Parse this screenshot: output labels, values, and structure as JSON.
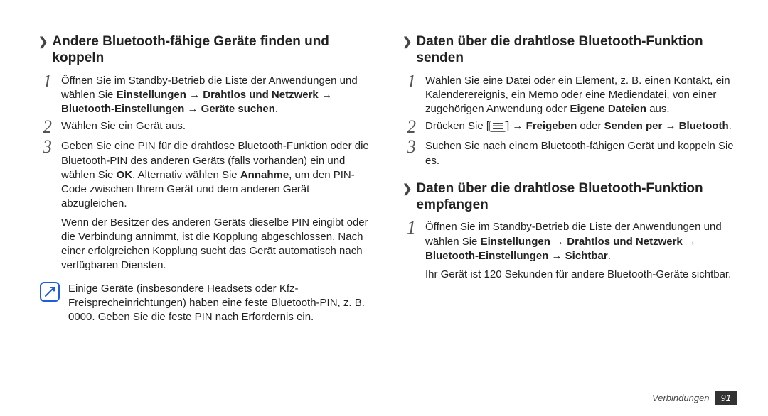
{
  "left": {
    "h1": {
      "chev": "❯",
      "text": "Andere Bluetooth-fähige Geräte finden und koppeln"
    },
    "steps": [
      {
        "num": "1",
        "parts": [
          {
            "t": "Öffnen Sie im Standby-Betrieb die Liste der Anwendungen und wählen Sie "
          },
          {
            "t": "Einstellungen",
            "b": true
          },
          {
            "t": " → ",
            "a": true
          },
          {
            "t": "Drahtlos und Netzwerk",
            "b": true
          },
          {
            "t": " → ",
            "a": true
          },
          {
            "t": "Bluetooth-Einstellungen",
            "b": true
          },
          {
            "t": " → ",
            "a": true
          },
          {
            "t": "Geräte suchen",
            "b": true
          },
          {
            "t": "."
          }
        ]
      },
      {
        "num": "2",
        "parts": [
          {
            "t": "Wählen Sie ein Gerät aus."
          }
        ]
      },
      {
        "num": "3",
        "parts": [
          {
            "t": "Geben Sie eine PIN für die drahtlose Bluetooth-Funktion oder die Bluetooth-PIN des anderen Geräts (falls vorhanden) ein und wählen Sie "
          },
          {
            "t": "OK",
            "b": true
          },
          {
            "t": ". Alternativ wählen Sie "
          },
          {
            "t": "Annahme",
            "b": true
          },
          {
            "t": ", um den PIN-Code zwischen Ihrem Gerät und dem anderen Gerät abzugleichen."
          }
        ]
      }
    ],
    "para": "Wenn der Besitzer des anderen Geräts dieselbe PIN eingibt oder die Verbindung annimmt, ist die Kopplung abgeschlossen. Nach einer erfolgreichen Kopplung sucht das Gerät automatisch nach verfügbaren Diensten.",
    "note": "Einige Geräte (insbesondere Headsets oder Kfz-Freisprecheinrichtungen) haben eine feste Bluetooth-PIN, z. B. 0000. Geben Sie die feste PIN nach Erfordernis ein."
  },
  "right": {
    "h1": {
      "chev": "❯",
      "text": "Daten über die drahtlose Bluetooth-Funktion senden"
    },
    "steps1": [
      {
        "num": "1",
        "parts": [
          {
            "t": "Wählen Sie eine Datei oder ein Element, z. B. einen Kontakt, ein Kalenderereignis, ein Memo oder eine Mediendatei, von einer zugehörigen Anwendung oder "
          },
          {
            "t": "Eigene Dateien",
            "b": true
          },
          {
            "t": " aus."
          }
        ]
      },
      {
        "num": "2",
        "parts": [
          {
            "t": "Drücken Sie ["
          },
          {
            "menu": true
          },
          {
            "t": "] → "
          },
          {
            "t": "Freigeben",
            "b": true
          },
          {
            "t": " oder "
          },
          {
            "t": "Senden per",
            "b": true
          },
          {
            "t": " → ",
            "a": true
          },
          {
            "t": "Bluetooth",
            "b": true
          },
          {
            "t": "."
          }
        ]
      },
      {
        "num": "3",
        "parts": [
          {
            "t": "Suchen Sie nach einem Bluetooth-fähigen Gerät und koppeln Sie es."
          }
        ]
      }
    ],
    "h2": {
      "chev": "❯",
      "text": "Daten über die drahtlose Bluetooth-Funktion empfangen"
    },
    "steps2": [
      {
        "num": "1",
        "parts": [
          {
            "t": "Öffnen Sie im Standby-Betrieb die Liste der Anwendungen und wählen Sie "
          },
          {
            "t": "Einstellungen",
            "b": true
          },
          {
            "t": " → ",
            "a": true
          },
          {
            "t": "Drahtlos und Netzwerk",
            "b": true
          },
          {
            "t": " → ",
            "a": true
          },
          {
            "t": "Bluetooth-Einstellungen",
            "b": true
          },
          {
            "t": " → ",
            "a": true
          },
          {
            "t": "Sichtbar",
            "b": true
          },
          {
            "t": "."
          }
        ]
      }
    ],
    "para2": "Ihr Gerät ist 120 Sekunden für andere Bluetooth-Geräte sichtbar."
  },
  "footer": {
    "label": "Verbindungen",
    "page": "91"
  }
}
